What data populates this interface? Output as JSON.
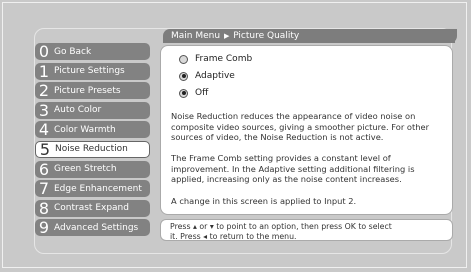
{
  "breadcrumb": {
    "part1": "Main Menu",
    "part2": "Picture Quality"
  },
  "menu": [
    {
      "num": "0",
      "label": "Go Back"
    },
    {
      "num": "1",
      "label": "Picture Settings"
    },
    {
      "num": "2",
      "label": "Picture Presets"
    },
    {
      "num": "3",
      "label": "Auto Color"
    },
    {
      "num": "4",
      "label": "Color Warmth"
    },
    {
      "num": "5",
      "label": "Noise Reduction"
    },
    {
      "num": "6",
      "label": "Green Stretch"
    },
    {
      "num": "7",
      "label": "Edge Enhancement"
    },
    {
      "num": "8",
      "label": "Contrast Expand"
    },
    {
      "num": "9",
      "label": "Advanced Settings"
    }
  ],
  "options": [
    "Frame Comb",
    "Adaptive",
    "Off"
  ],
  "description": {
    "p1": "Noise Reduction reduces the appearance of video noise on composite video sources, giving a smoother picture. For other sources of video, the Noise Reduction is not active.",
    "p2": "The Frame Comb setting provides a constant level of improvement. In the Adaptive setting additional filtering is applied, increasing only as the noise content increases.",
    "p3": "A change in this screen is applied to Input 2."
  },
  "status": {
    "line1": "Press ▴ or ▾ to point to an option, then press OK to select",
    "line2": "it. Press ◂ to return to the menu."
  }
}
